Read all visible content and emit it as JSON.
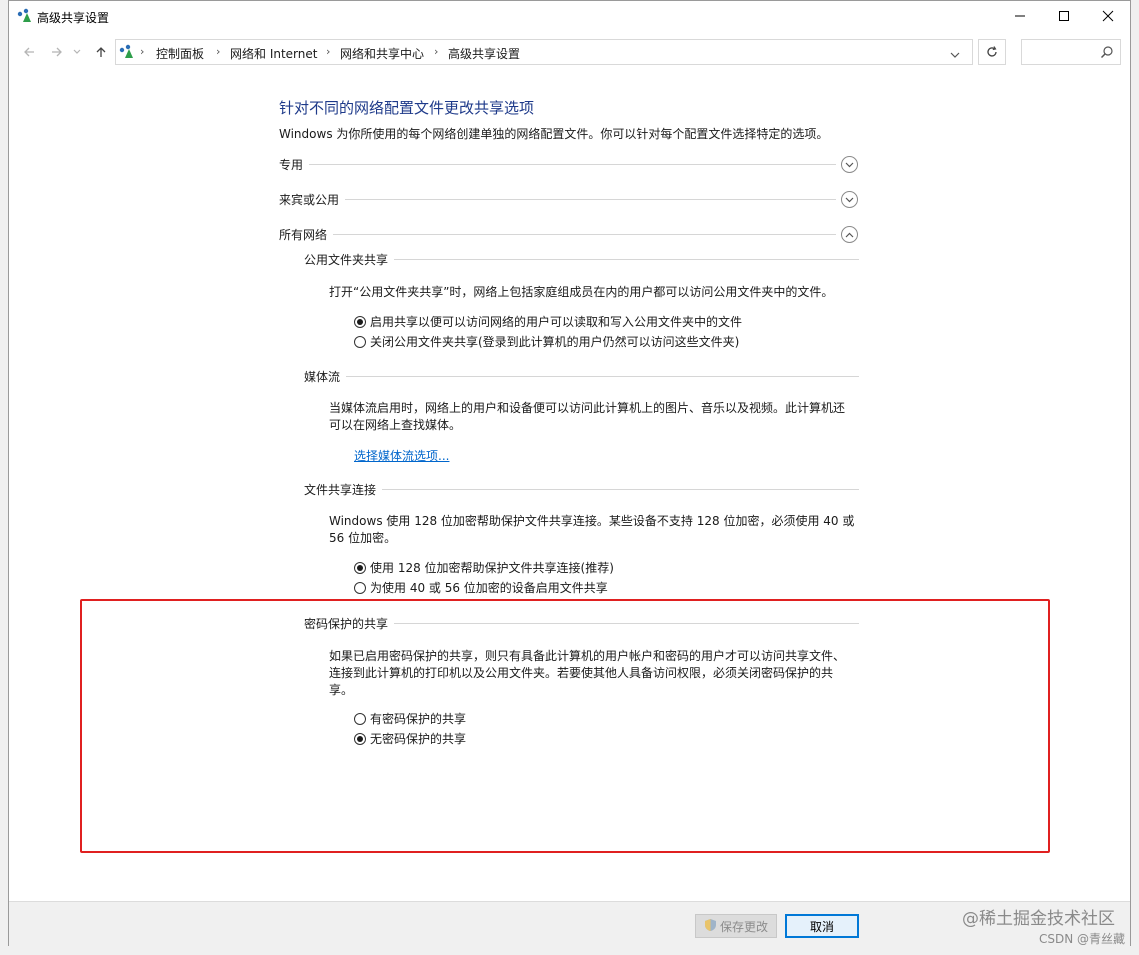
{
  "window": {
    "title": "高级共享设置",
    "controls": {
      "minimize": "minimize",
      "maximize": "maximize",
      "close": "close"
    }
  },
  "address_bar": {
    "breadcrumbs": [
      "控制面板",
      "网络和 Internet",
      "网络和共享中心",
      "高级共享设置"
    ],
    "search_placeholder": ""
  },
  "page": {
    "heading": "针对不同的网络配置文件更改共享选项",
    "description": "Windows 为你所使用的每个网络创建单独的网络配置文件。你可以针对每个配置文件选择特定的选项。",
    "profiles": [
      {
        "label": "专用",
        "expanded": false
      },
      {
        "label": "来宾或公用",
        "expanded": false
      },
      {
        "label": "所有网络",
        "expanded": true
      }
    ],
    "sections": {
      "public_folder": {
        "title": "公用文件夹共享",
        "text": "打开“公用文件夹共享”时，网络上包括家庭组成员在内的用户都可以访问公用文件夹中的文件。",
        "options": [
          {
            "label": "启用共享以便可以访问网络的用户可以读取和写入公用文件夹中的文件",
            "checked": true
          },
          {
            "label": "关闭公用文件夹共享(登录到此计算机的用户仍然可以访问这些文件夹)",
            "checked": false
          }
        ]
      },
      "media": {
        "title": "媒体流",
        "text_line1": "当媒体流启用时，网络上的用户和设备便可以访问此计算机上的图片、音乐以及视频。此计算机还",
        "text_line2": "可以在网络上查找媒体。",
        "link": "选择媒体流选项..."
      },
      "file_sharing": {
        "title": "文件共享连接",
        "text_line1": "Windows 使用 128 位加密帮助保护文件共享连接。某些设备不支持 128 位加密，必须使用 40 或",
        "text_line2": "56 位加密。",
        "options": [
          {
            "label": "使用 128 位加密帮助保护文件共享连接(推荐)",
            "checked": true
          },
          {
            "label": "为使用 40 或 56 位加密的设备启用文件共享",
            "checked": false
          }
        ]
      },
      "password": {
        "title": "密码保护的共享",
        "text_line1": "如果已启用密码保护的共享，则只有具备此计算机的用户帐户和密码的用户才可以访问共享文件、",
        "text_line2": "连接到此计算机的打印机以及公用文件夹。若要使其他人具备访问权限，必须关闭密码保护的共",
        "text_line3": "享。",
        "options": [
          {
            "label": "有密码保护的共享",
            "checked": false
          },
          {
            "label": "无密码保护的共享",
            "checked": true
          }
        ]
      }
    }
  },
  "footer": {
    "save_label": "保存更改",
    "cancel_label": "取消"
  },
  "watermark": {
    "line1": "@稀土掘金技术社区",
    "line2": "CSDN @青丝藏"
  },
  "colors": {
    "heading": "#1e3a8a",
    "link": "#0066cc",
    "highlight_border": "#e02020",
    "primary_button_border": "#0078d7"
  }
}
